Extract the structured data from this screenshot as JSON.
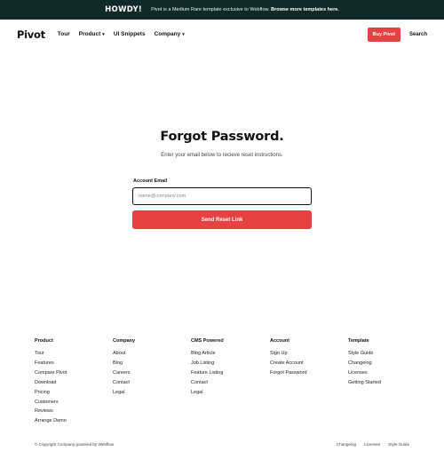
{
  "banner": {
    "badge": "HOWDY!",
    "message_prefix": "Pivot is a Medium Rare template exclusive to Webflow.",
    "message_link": "Browse more templates here."
  },
  "nav": {
    "logo": "Pivot",
    "links": [
      {
        "label": "Tour",
        "dropdown": false
      },
      {
        "label": "Product",
        "dropdown": true
      },
      {
        "label": "UI Snippets",
        "dropdown": false
      },
      {
        "label": "Company",
        "dropdown": true
      }
    ],
    "buy_button": "Buy Pivot",
    "search": "Search"
  },
  "form": {
    "title": "Forgot Password.",
    "subtitle": "Enter your email below to recieve reset instructions.",
    "email_label": "Account Email",
    "email_placeholder": "name@company.com",
    "email_value": "",
    "submit_label": "Send Reset Link"
  },
  "footer": {
    "columns": [
      {
        "title": "Product",
        "links": [
          "Tour",
          "Features",
          "Compare Pivot",
          "Download",
          "Pricing",
          "Customers",
          "Reviews",
          "Arrange Demo"
        ]
      },
      {
        "title": "Company",
        "links": [
          "About",
          "Blog",
          "Careers",
          "Contact",
          "Legal"
        ]
      },
      {
        "title": "CMS Powered",
        "links": [
          "Blog Article",
          "Job Listing",
          "Feature Listing",
          "Contact",
          "Legal"
        ]
      },
      {
        "title": "Account",
        "links": [
          "Sign Up",
          "Create Account",
          "Forgot Password"
        ]
      },
      {
        "title": "Template",
        "links": [
          "Style Guide",
          "Changelog",
          "Licenses",
          "Getting Started"
        ]
      }
    ],
    "copyright": "© Copyright Company powered by Webflow",
    "bottom_links": [
      "Changelog",
      "Licenses",
      "Style Guide"
    ]
  },
  "colors": {
    "banner_bg": "#0f2a28",
    "accent": "#e84142"
  }
}
